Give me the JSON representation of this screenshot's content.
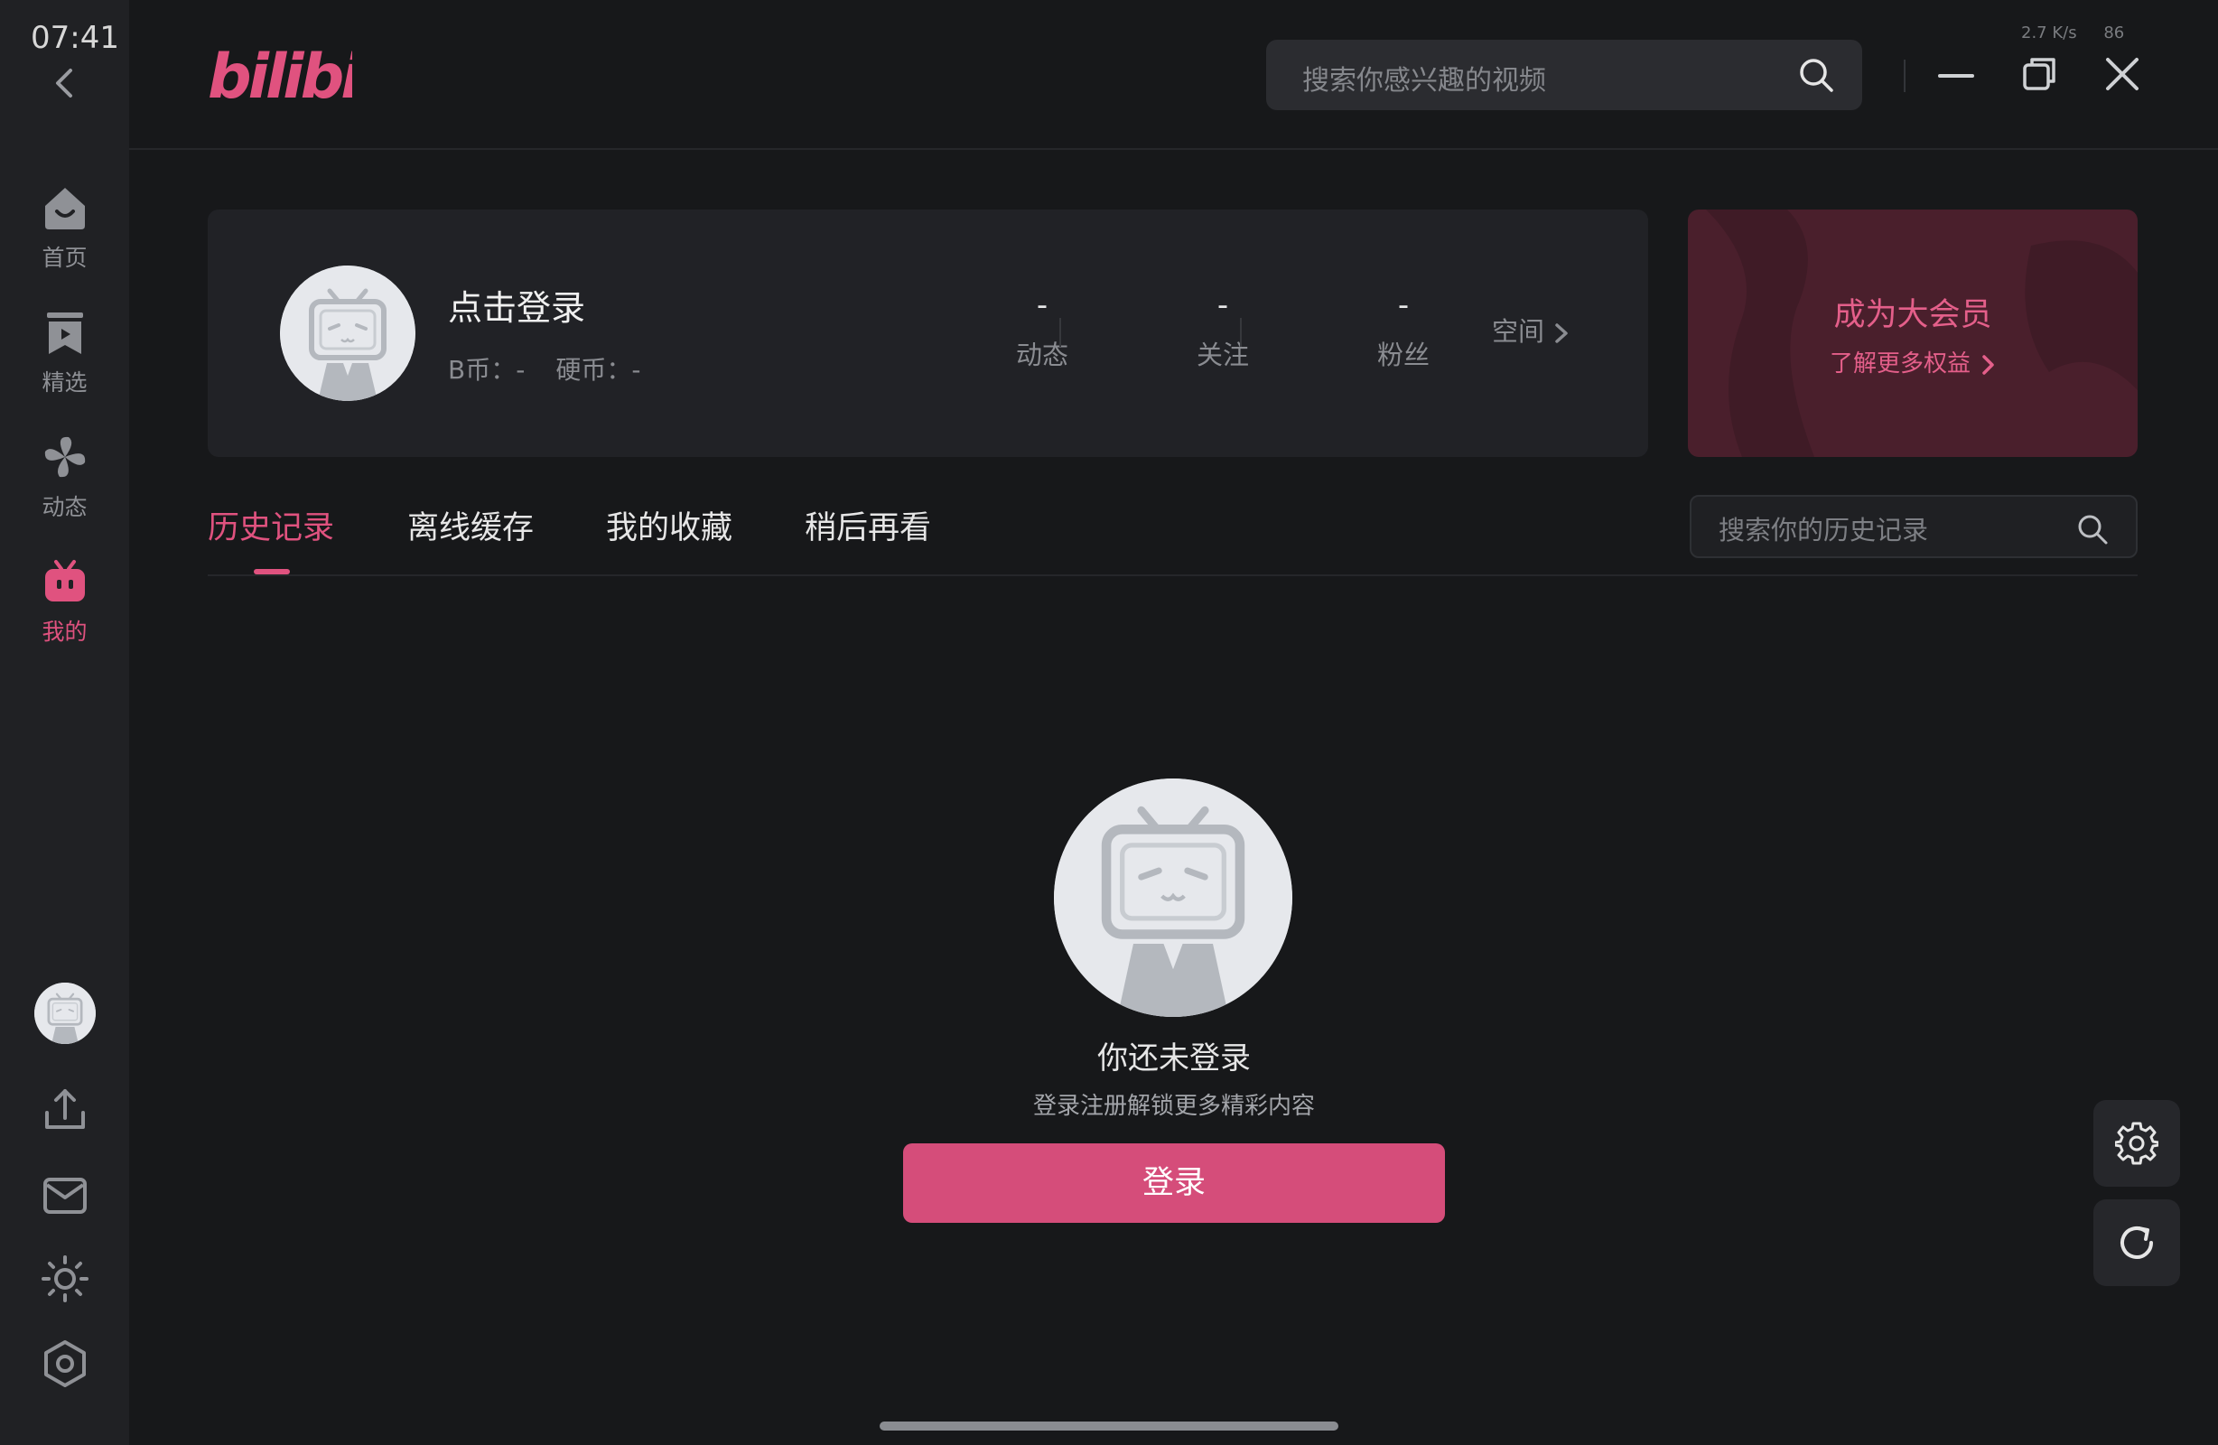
{
  "status_bar": {
    "time": "07:41",
    "speed": "2.7 K/s",
    "battery": "86"
  },
  "app": {
    "brand": "bilibili"
  },
  "top_search": {
    "placeholder": "搜索你感兴趣的视频"
  },
  "nav": {
    "items": [
      {
        "label": "首页",
        "icon": "home-icon"
      },
      {
        "label": "精选",
        "icon": "bookmark-icon"
      },
      {
        "label": "动态",
        "icon": "pinwheel-icon"
      },
      {
        "label": "我的",
        "icon": "tv-mascot-icon",
        "active": true
      }
    ]
  },
  "profile": {
    "title": "点击登录",
    "b_coin": "B币：-",
    "coin": "硬币：-",
    "stats": [
      {
        "value": "-",
        "label": "动态"
      },
      {
        "value": "-",
        "label": "关注"
      },
      {
        "value": "-",
        "label": "粉丝"
      }
    ],
    "space_label": "空间"
  },
  "vip": {
    "title": "成为大会员",
    "subtitle": "了解更多权益"
  },
  "tabs": [
    {
      "label": "历史记录",
      "active": true
    },
    {
      "label": "离线缓存"
    },
    {
      "label": "我的收藏"
    },
    {
      "label": "稍后再看"
    }
  ],
  "history_search": {
    "placeholder": "搜索你的历史记录"
  },
  "empty_state": {
    "title": "你还未登录",
    "subtitle": "登录注册解锁更多精彩内容",
    "button_label": "登录"
  },
  "colors": {
    "accent": "#e0527f",
    "button": "#d54d7a",
    "background": "#17181a",
    "sidebar": "#202124",
    "card": "#212226",
    "vip_card": "#4a1f2c"
  }
}
